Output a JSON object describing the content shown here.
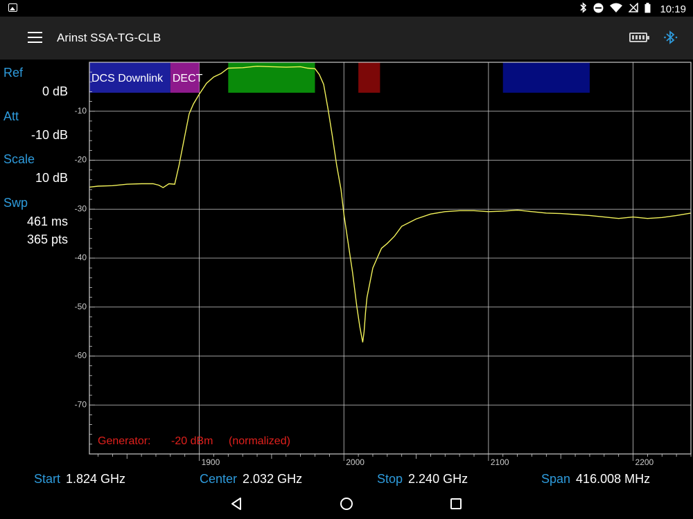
{
  "status_bar": {
    "time": "10:19",
    "icons": [
      "gallery-icon",
      "bluetooth-icon",
      "dnd-icon",
      "wifi-icon",
      "no-sim-icon",
      "battery-icon"
    ]
  },
  "app_bar": {
    "title": "Arinst SSA-TG-CLB",
    "icons": [
      "menu-icon",
      "battery-icon",
      "bluetooth-icon"
    ]
  },
  "settings": {
    "ref": {
      "label": "Ref",
      "value": "0 dB"
    },
    "att": {
      "label": "Att",
      "value": "-10 dB"
    },
    "scale": {
      "label": "Scale",
      "value": "10 dB"
    },
    "swp": {
      "label": "Swp",
      "value_time": "461 ms",
      "value_pts": "365 pts"
    }
  },
  "generator": {
    "label": "Generator:",
    "value": "-20 dBm",
    "note": "(normalized)"
  },
  "bottom": {
    "start": {
      "label": "Start",
      "value": "1.824 GHz"
    },
    "center": {
      "label": "Center",
      "value": "2.032 GHz"
    },
    "stop": {
      "label": "Stop",
      "value": "2.240 GHz"
    },
    "span": {
      "label": "Span",
      "value": "416.008 MHz"
    }
  },
  "colors": {
    "background": "#000000",
    "trace": "#f2f25a",
    "grid": "#cccccc",
    "accent": "#2e9bdc",
    "generator_text": "#e0201c",
    "app_bar": "#212121"
  },
  "bands": [
    {
      "name": "DCS Downlink",
      "start": 1824,
      "end": 1880,
      "color": "#1c1f9c"
    },
    {
      "name": "DECT",
      "start": 1880,
      "end": 1900,
      "color": "#8e1a8c"
    },
    {
      "name": "",
      "start": 1920,
      "end": 1980,
      "color": "#0a8a0a"
    },
    {
      "name": "",
      "start": 2010,
      "end": 2025,
      "color": "#7c0808"
    },
    {
      "name": "",
      "start": 2110,
      "end": 2170,
      "color": "#040c7e"
    }
  ],
  "chart_data": {
    "type": "line",
    "xlim": [
      1824,
      2240
    ],
    "ylim": [
      -80,
      0
    ],
    "x_ticks": [
      1900,
      2000,
      2100,
      2200
    ],
    "y_ticks": [
      -10,
      -20,
      -30,
      -40,
      -50,
      -60,
      -70
    ],
    "grid": true,
    "series": [
      {
        "x": [
          1824,
          1830,
          1840,
          1850,
          1860,
          1868,
          1872,
          1875,
          1879,
          1883,
          1886,
          1890,
          1893,
          1896,
          1900,
          1905,
          1910,
          1915,
          1920,
          1930,
          1940,
          1950,
          1960,
          1970,
          1975,
          1980,
          1983,
          1986,
          1989,
          1992,
          1995,
          1998,
          2000,
          2003,
          2006,
          2009,
          2011,
          2013,
          2014,
          2015,
          2016,
          2018,
          2020,
          2023,
          2026,
          2030,
          2035,
          2040,
          2050,
          2060,
          2070,
          2080,
          2090,
          2100,
          2110,
          2120,
          2130,
          2140,
          2150,
          2160,
          2170,
          2180,
          2190,
          2200,
          2210,
          2220,
          2230,
          2240
        ],
        "y": [
          -25.5,
          -25.3,
          -25.2,
          -24.9,
          -24.8,
          -24.8,
          -25.1,
          -25.6,
          -24.8,
          -24.9,
          -21,
          -15,
          -10.5,
          -8.5,
          -6.5,
          -4.3,
          -3.0,
          -2.3,
          -1.2,
          -1.1,
          -0.8,
          -0.9,
          -1.0,
          -0.9,
          -1.2,
          -1.3,
          -2.5,
          -4.5,
          -9.5,
          -15,
          -21,
          -26,
          -31,
          -37,
          -43,
          -50,
          -54,
          -57.2,
          -55,
          -51,
          -48,
          -45,
          -42,
          -40,
          -38,
          -37,
          -35.5,
          -33.5,
          -32,
          -31,
          -30.5,
          -30.3,
          -30.3,
          -30.5,
          -30.4,
          -30.2,
          -30.5,
          -30.8,
          -30.9,
          -31.1,
          -31.3,
          -31.6,
          -31.9,
          -31.6,
          -31.9,
          -31.7,
          -31.3,
          -30.8
        ]
      }
    ]
  }
}
